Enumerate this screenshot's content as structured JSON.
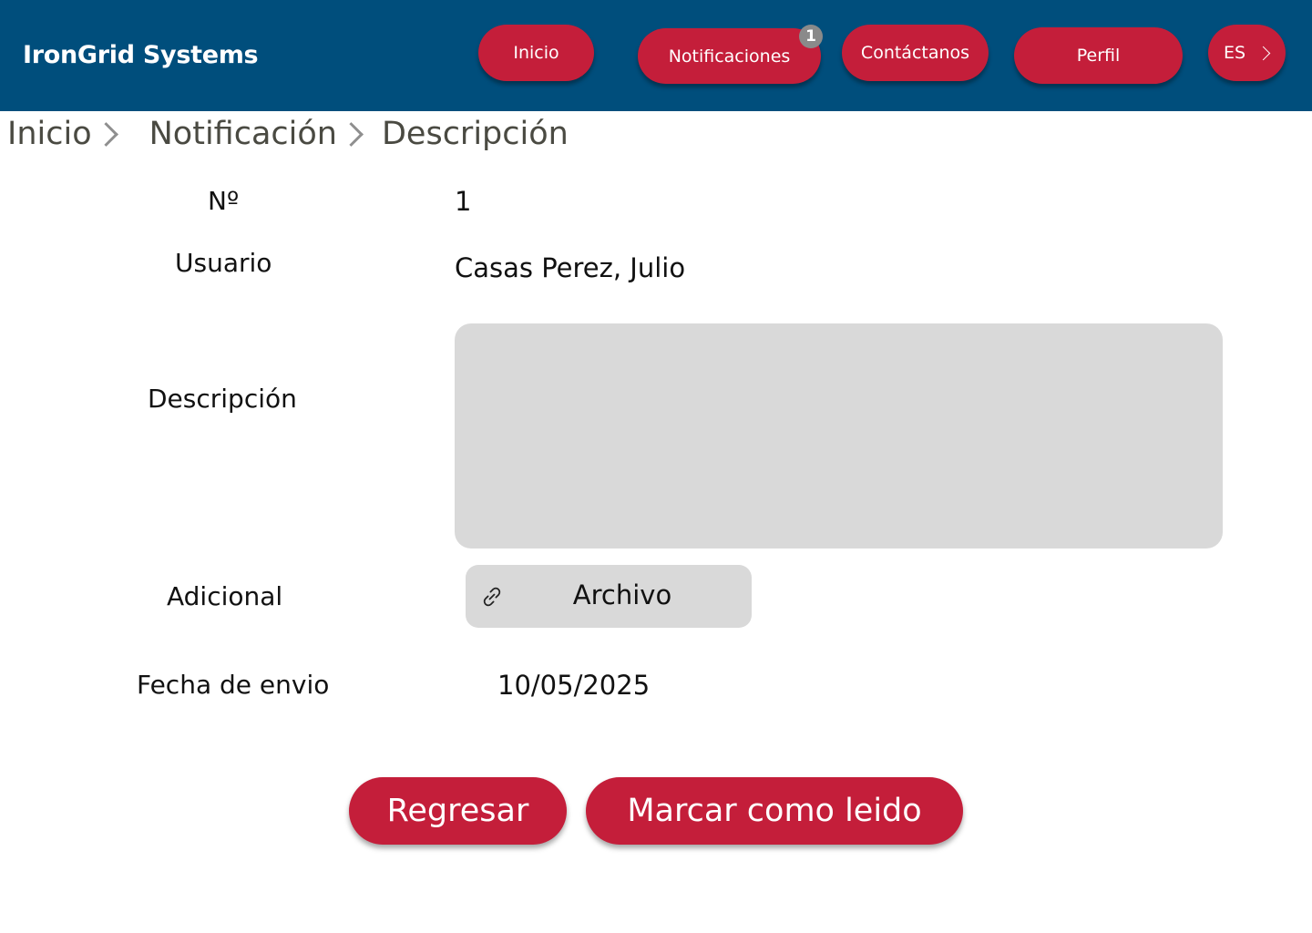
{
  "header": {
    "brand": "IronGrid Systems",
    "nav": {
      "inicio": "Inicio",
      "notificaciones": "Notificaciones",
      "notificaciones_badge": "1",
      "contactanos": "Contáctanos",
      "perfil": "Perfil",
      "language": "ES"
    }
  },
  "breadcrumb": {
    "items": [
      "Inicio",
      "Notificación",
      "Descripción"
    ]
  },
  "detail": {
    "numero_label": "Nº",
    "numero_value": "1",
    "usuario_label": "Usuario",
    "usuario_value": "Casas Perez, Julio",
    "descripcion_label": "Descripción",
    "descripcion_value": "",
    "adicional_label": "Adicional",
    "archivo_label": "Archivo",
    "fecha_label": "Fecha de envio",
    "fecha_value": "10/05/2025"
  },
  "actions": {
    "back": "Regresar",
    "mark_read": "Marcar como leido"
  },
  "colors": {
    "header_bg": "#004E7C",
    "accent": "#C41E3A",
    "field_bg": "#D9D9D9",
    "badge_bg": "#8A8A8A"
  },
  "icons": {
    "language_chevron": "chevron-right-icon",
    "breadcrumb_separator": "chevron-right-icon",
    "attachment": "link-icon"
  }
}
